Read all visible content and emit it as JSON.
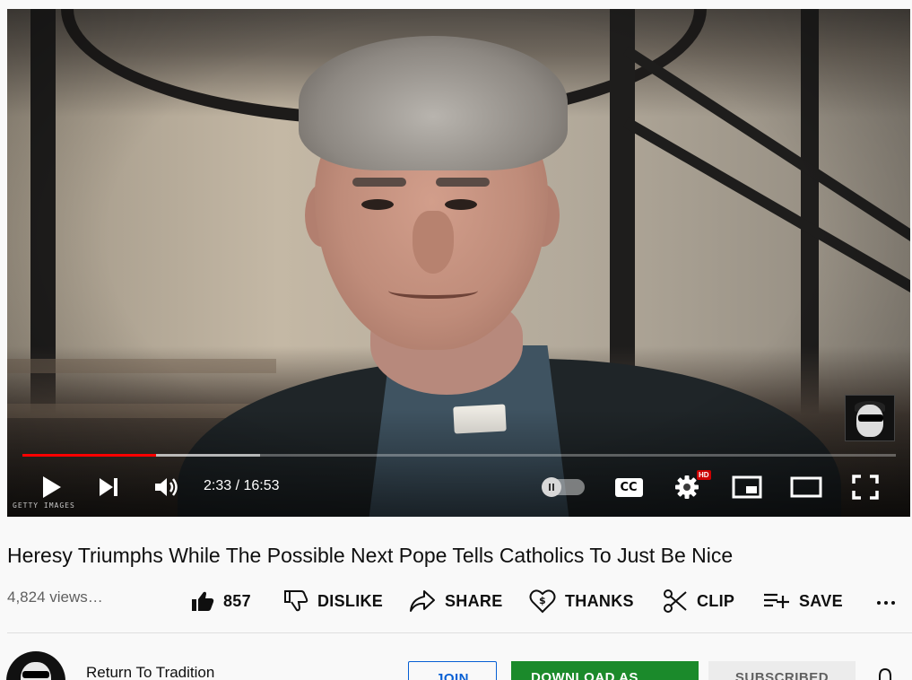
{
  "player": {
    "watermark": "GETTY IMAGES",
    "progress_fraction": 0.153,
    "buffered_fraction": 0.272,
    "current_time": "2:33",
    "duration": "16:53",
    "time_display": "2:33 / 16:53",
    "autoplay_on": false,
    "cc_label": "CC",
    "hd_badge": "HD",
    "accent_color": "#ff0000"
  },
  "video": {
    "title": "Heresy Triumphs While The Possible Next Pope Tells Catholics To Just Be Nice",
    "views": "4,824 views…"
  },
  "actions": {
    "like_count": "857",
    "dislike_label": "DISLIKE",
    "share_label": "SHARE",
    "thanks_label": "THANKS",
    "clip_label": "CLIP",
    "save_label": "SAVE"
  },
  "channel": {
    "name": "Return To Tradition",
    "join_label": "JOIN",
    "download_label": "DOWNLOAD AS",
    "subscribed_label": "SUBSCRIBED",
    "join_color": "#065fd4",
    "download_color": "#1b8a2b"
  }
}
